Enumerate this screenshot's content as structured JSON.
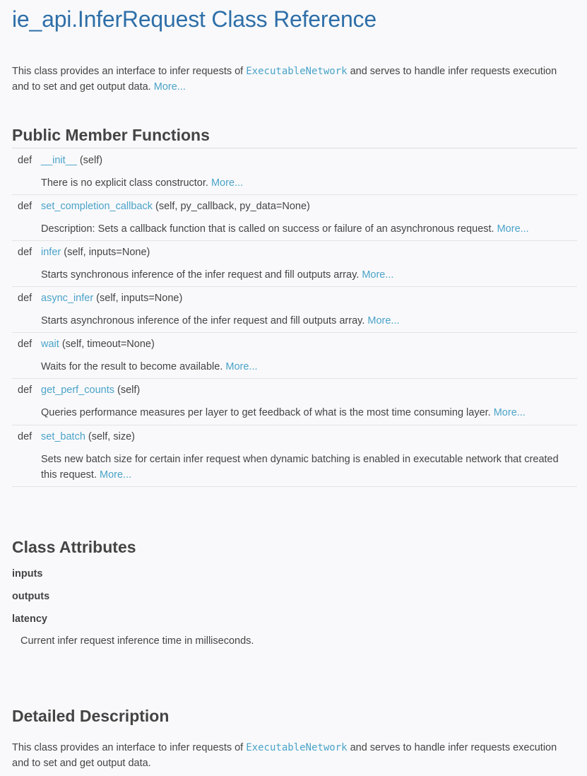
{
  "title": "ie_api.InferRequest Class Reference",
  "brief": {
    "prefix": "This class provides an interface to infer requests of ",
    "code": "ExecutableNetwork",
    "suffix": " and serves to handle infer requests execution and to set and get output data.",
    "more": "More..."
  },
  "public_members": {
    "heading": "Public Member Functions",
    "items": [
      {
        "def": "def",
        "name": "__init__",
        "args": " (self)",
        "desc": "There is no explicit class constructor. ",
        "more": "More..."
      },
      {
        "def": "def",
        "name": "set_completion_callback",
        "args": " (self, py_callback, py_data=None)",
        "desc": "Description: Sets a callback function that is called on success or failure of an asynchronous request. ",
        "more": "More..."
      },
      {
        "def": "def",
        "name": "infer",
        "args": " (self, inputs=None)",
        "desc": "Starts synchronous inference of the infer request and fill outputs array. ",
        "more": "More..."
      },
      {
        "def": "def",
        "name": "async_infer",
        "args": " (self, inputs=None)",
        "desc": "Starts asynchronous inference of the infer request and fill outputs array. ",
        "more": "More..."
      },
      {
        "def": "def",
        "name": "wait",
        "args": " (self, timeout=None)",
        "desc": "Waits for the result to become available. ",
        "more": "More..."
      },
      {
        "def": "def",
        "name": "get_perf_counts",
        "args": " (self)",
        "desc": "Queries performance measures per layer to get feedback of what is the most time consuming layer. ",
        "more": "More..."
      },
      {
        "def": "def",
        "name": "set_batch",
        "args": " (self, size)",
        "desc": "Sets new batch size for certain infer request when dynamic batching is enabled in executable network that created this request. ",
        "more": "More..."
      }
    ]
  },
  "class_attributes": {
    "heading": "Class Attributes",
    "items": [
      "inputs",
      "outputs",
      "latency"
    ],
    "latency_desc": "Current infer request inference time in milliseconds."
  },
  "detailed": {
    "heading": "Detailed Description",
    "prefix": "This class provides an interface to infer requests of ",
    "code": "ExecutableNetwork",
    "suffix": " and serves to handle infer requests execution and to set and get output data."
  }
}
